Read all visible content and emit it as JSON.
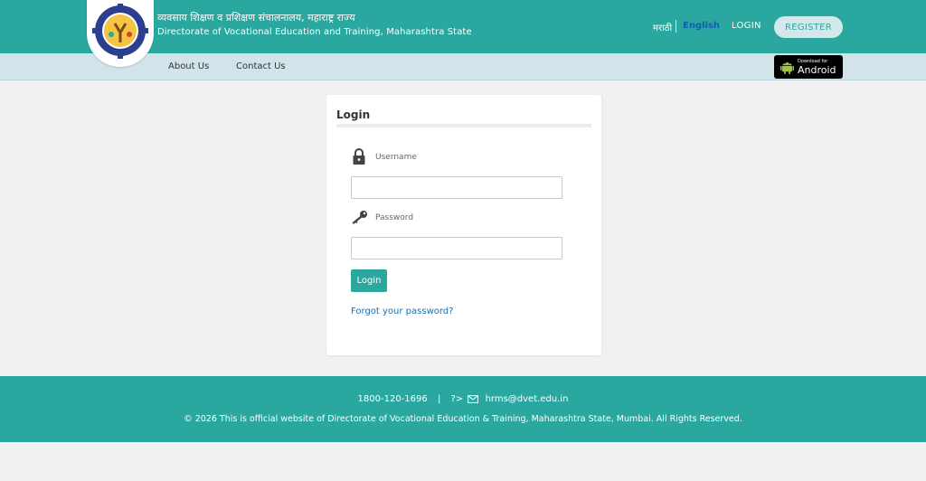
{
  "header": {
    "org_name_marathi": "व्यवसाय शिक्षण व प्रशिक्षण संचालनालय, महाराष्ट्र राज्य",
    "org_name_english": "Directorate of Vocational Education and Training, Maharashtra State",
    "lang_marathi": "मराठी",
    "lang_english": "English",
    "login_label": "LOGIN",
    "register_label": "REGISTER"
  },
  "nav": {
    "about_label": "About Us",
    "contact_label": "Contact Us",
    "android_small": "Download for",
    "android_big": "Android"
  },
  "login_card": {
    "title": "Login",
    "username_label": "Username",
    "username_value": "",
    "password_label": "Password",
    "password_value": "",
    "login_button": "Login",
    "forgot_link": "Forgot your password?"
  },
  "footer": {
    "phone": "1800-120-1696",
    "separator": "|",
    "prefix": "?>",
    "email": "hrms@dvet.edu.in",
    "copyright": "© 2026 This is official website of Directorate of Vocational Education & Training, Maharashtra State, Mumbai. All Rights Reserved."
  },
  "colors": {
    "primary": "#2aa8a0",
    "nav_bg": "#d2e3ea",
    "link": "#1d6fa5"
  },
  "icons": {
    "logo": "dvet-emblem-icon",
    "username": "lock-icon",
    "password": "key-icon",
    "android": "android-icon",
    "email": "envelope-icon"
  }
}
